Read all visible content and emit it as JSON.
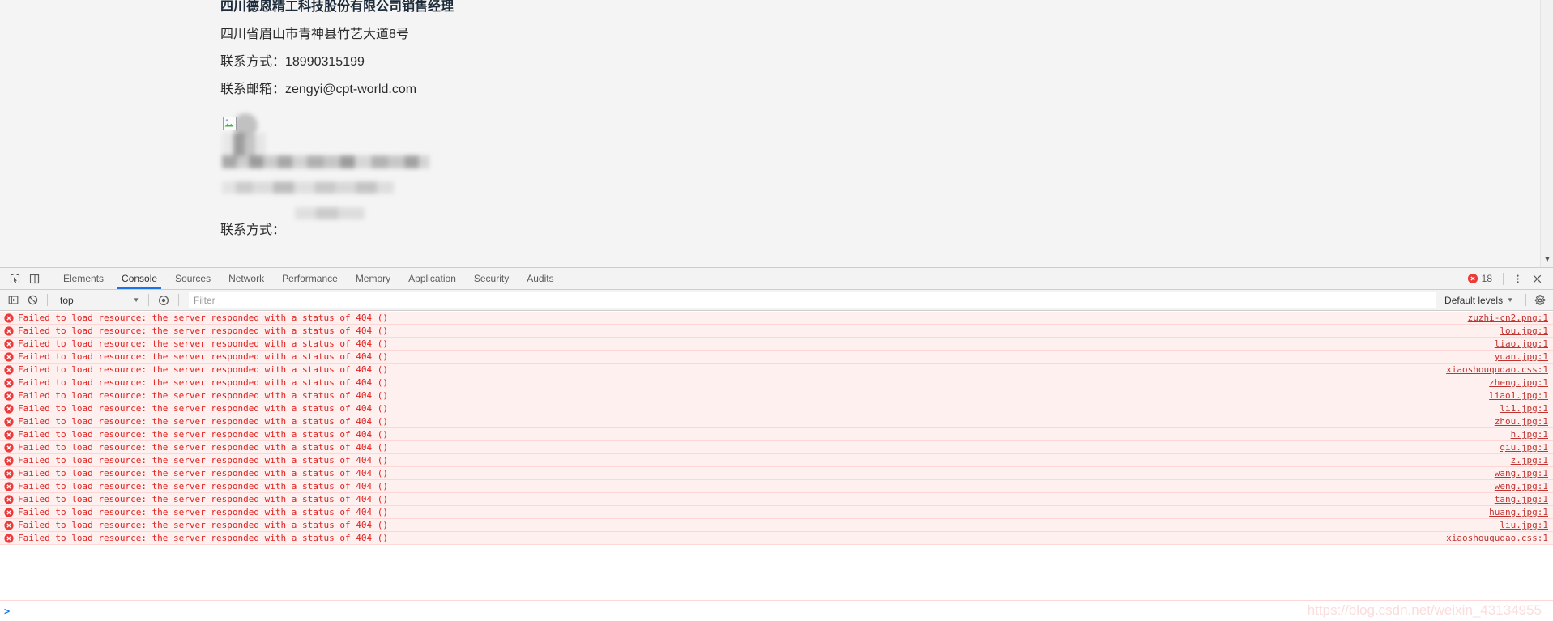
{
  "page": {
    "lines": [
      {
        "text": "四川德恩精工科技股份有限公司销售经理",
        "heading": true
      },
      {
        "text": "四川省眉山市青神县竹艺大道8号",
        "heading": false
      },
      {
        "text": "联系方式：18990315199",
        "heading": false
      },
      {
        "text": "联系邮箱：zengyi@cpt-world.com",
        "heading": false
      }
    ],
    "trailing_label": "联系方式："
  },
  "devtools": {
    "tabs": [
      {
        "label": "Elements",
        "active": false
      },
      {
        "label": "Console",
        "active": true
      },
      {
        "label": "Sources",
        "active": false
      },
      {
        "label": "Network",
        "active": false
      },
      {
        "label": "Performance",
        "active": false
      },
      {
        "label": "Memory",
        "active": false
      },
      {
        "label": "Application",
        "active": false
      },
      {
        "label": "Security",
        "active": false
      },
      {
        "label": "Audits",
        "active": false
      }
    ],
    "error_count": "18",
    "toolbar": {
      "context": "top",
      "filter_placeholder": "Filter",
      "levels": "Default levels"
    },
    "prompt": {
      "chevron": ">",
      "value": ""
    },
    "messages": [
      {
        "text": "Failed to load resource: the server responded with a status of 404 ()",
        "source": "zuzhi-cn2.png:1"
      },
      {
        "text": "Failed to load resource: the server responded with a status of 404 ()",
        "source": "lou.jpg:1"
      },
      {
        "text": "Failed to load resource: the server responded with a status of 404 ()",
        "source": "liao.jpg:1"
      },
      {
        "text": "Failed to load resource: the server responded with a status of 404 ()",
        "source": "yuan.jpg:1"
      },
      {
        "text": "Failed to load resource: the server responded with a status of 404 ()",
        "source": "xiaoshouqudao.css:1"
      },
      {
        "text": "Failed to load resource: the server responded with a status of 404 ()",
        "source": "zheng.jpg:1"
      },
      {
        "text": "Failed to load resource: the server responded with a status of 404 ()",
        "source": "liao1.jpg:1"
      },
      {
        "text": "Failed to load resource: the server responded with a status of 404 ()",
        "source": "li1.jpg:1"
      },
      {
        "text": "Failed to load resource: the server responded with a status of 404 ()",
        "source": "zhou.jpg:1"
      },
      {
        "text": "Failed to load resource: the server responded with a status of 404 ()",
        "source": "h.jpg:1"
      },
      {
        "text": "Failed to load resource: the server responded with a status of 404 ()",
        "source": "qiu.jpg:1"
      },
      {
        "text": "Failed to load resource: the server responded with a status of 404 ()",
        "source": "z.jpg:1"
      },
      {
        "text": "Failed to load resource: the server responded with a status of 404 ()",
        "source": "wang.jpg:1"
      },
      {
        "text": "Failed to load resource: the server responded with a status of 404 ()",
        "source": "weng.jpg:1"
      },
      {
        "text": "Failed to load resource: the server responded with a status of 404 ()",
        "source": "tang.jpg:1"
      },
      {
        "text": "Failed to load resource: the server responded with a status of 404 ()",
        "source": "huang.jpg:1"
      },
      {
        "text": "Failed to load resource: the server responded with a status of 404 ()",
        "source": "liu.jpg:1"
      },
      {
        "text": "Failed to load resource: the server responded with a status of 404 ()",
        "source": "xiaoshouqudao.css:1"
      }
    ]
  },
  "watermark": "https://blog.csdn.net/weixin_43134955",
  "colors": {
    "error_red": "#e2221e",
    "error_row_bg": "#fff0f0",
    "accent_blue": "#1a73e8",
    "toolbar_bg": "#f3f3f3"
  }
}
